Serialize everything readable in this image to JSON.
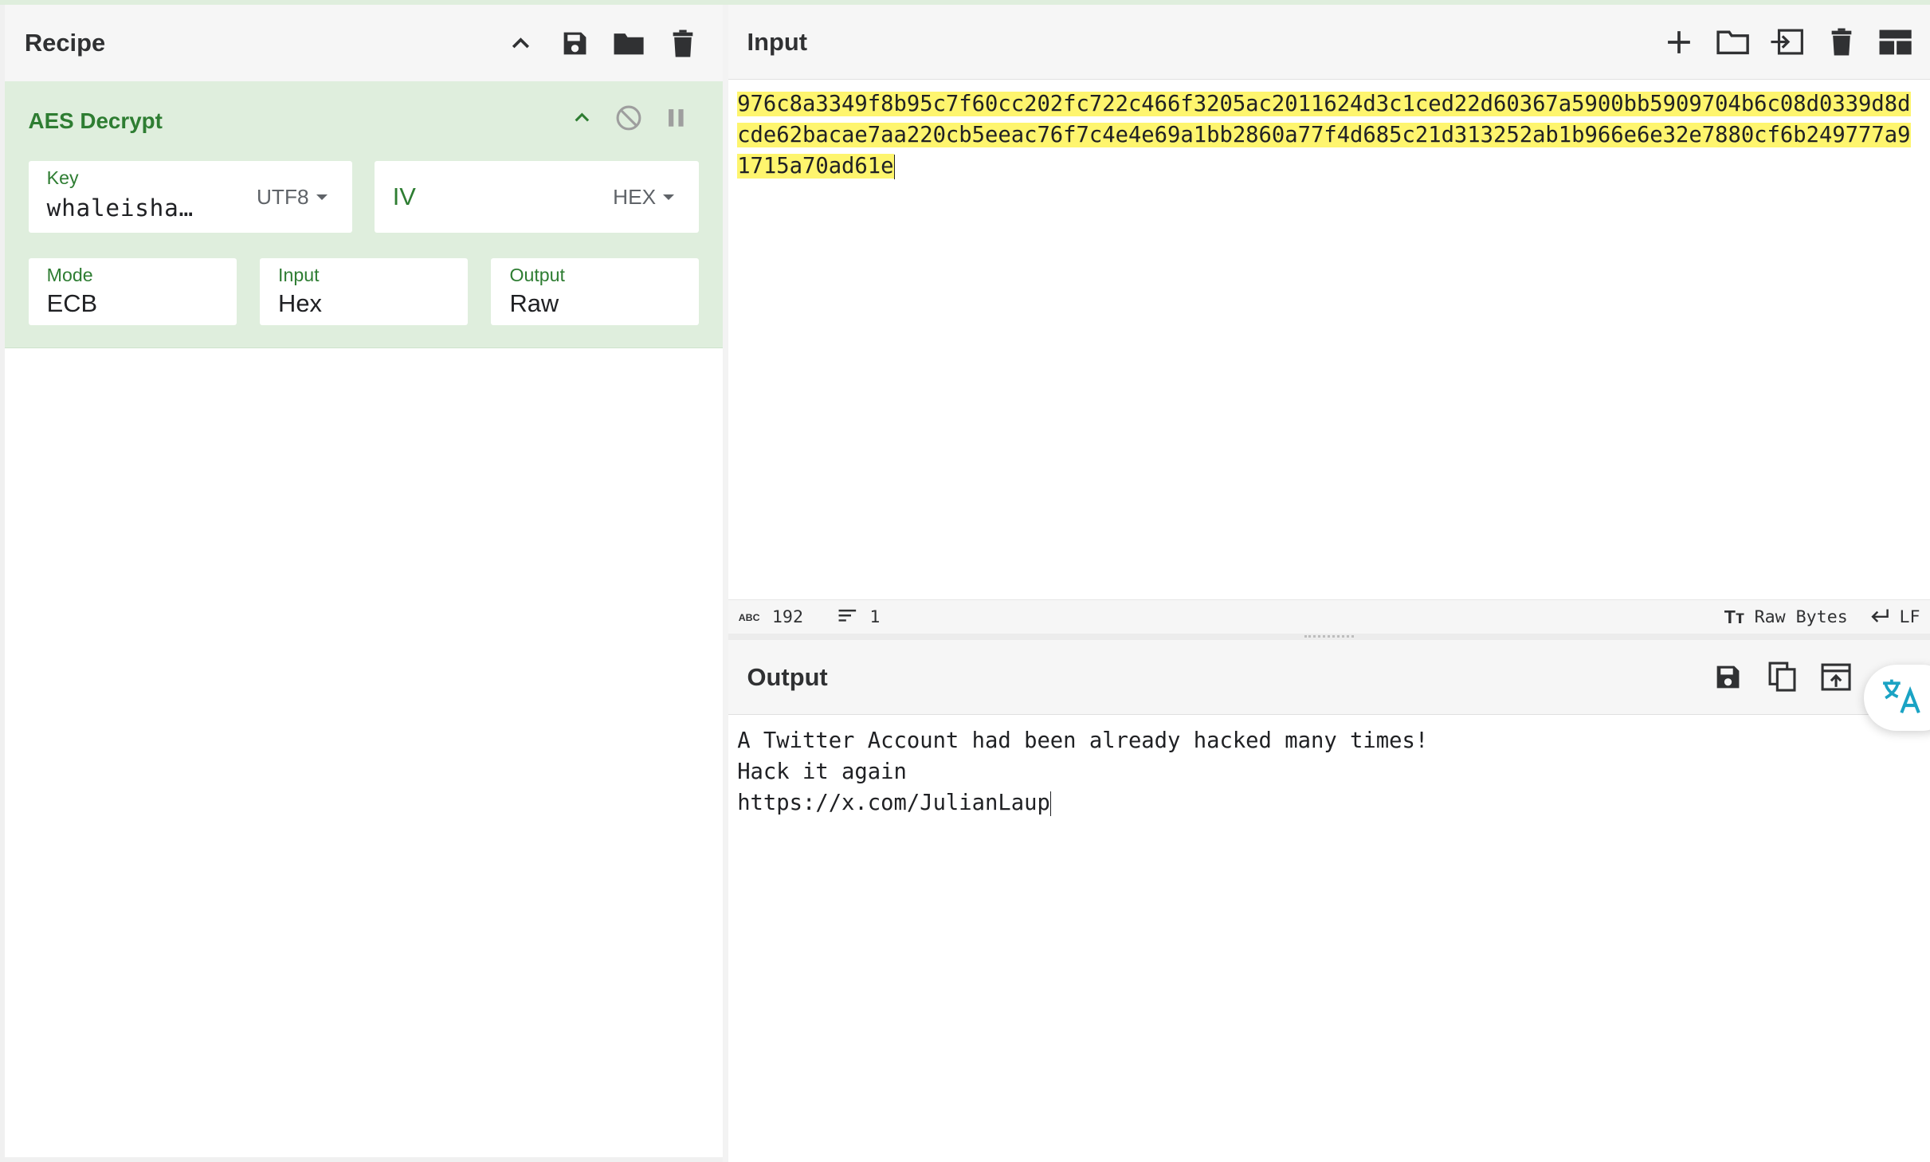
{
  "recipe": {
    "title": "Recipe",
    "operation": {
      "name": "AES Decrypt",
      "key": {
        "label": "Key",
        "value": "whaleisha…",
        "encoding": "UTF8"
      },
      "iv": {
        "label": "IV",
        "value": "",
        "encoding": "HEX"
      },
      "mode": {
        "label": "Mode",
        "value": "ECB"
      },
      "input": {
        "label": "Input",
        "value": "Hex"
      },
      "output": {
        "label": "Output",
        "value": "Raw"
      }
    }
  },
  "input": {
    "title": "Input",
    "text": "976c8a3349f8b95c7f60cc202fc722c466f3205ac2011624d3c1ced22d60367a5900bb5909704b6c08d0339d8dcde62bacae7aa220cb5eeac76f7c4e4e69a1bb2860a77f4d685c21d313252ab1b966e6e32e7880cf6b249777a91715a70ad61e",
    "status": {
      "length": "192",
      "lines": "1",
      "encoding": "Raw Bytes",
      "eol": "LF"
    }
  },
  "output": {
    "title": "Output",
    "lines": [
      "A Twitter Account had been already hacked many times!",
      "Hack it again",
      "https://x.com/JulianLaup"
    ]
  },
  "colors": {
    "operation_bg": "#dfeedd",
    "operation_accent": "#2e7d32",
    "highlight": "#fef56e",
    "translate_icon": "#1aa3c4"
  }
}
